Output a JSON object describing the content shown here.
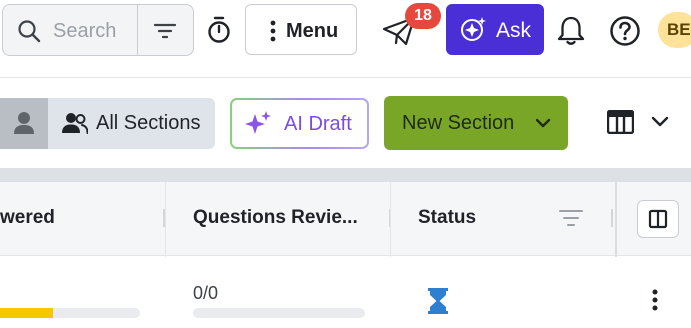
{
  "header": {
    "search_placeholder": "Search",
    "menu_label": "Menu",
    "notification_count": "18",
    "ask_label": "Ask",
    "avatar_initials": "BE"
  },
  "toolbar": {
    "sections_label": "All Sections",
    "ai_draft_label": "AI Draft",
    "new_section_label": "New Section"
  },
  "table": {
    "columns": [
      "wered",
      "Questions Revie...",
      "Status"
    ],
    "row": {
      "answered_progress": 0.38,
      "reviewed_text": "0/0",
      "reviewed_progress": 0
    }
  },
  "colors": {
    "ask_button": "#4b2fd6",
    "new_section_button": "#7aa628",
    "badge": "#e5483d",
    "answered_bar": "#f7c800",
    "status_icon": "#2f7fd0",
    "avatar_bg": "#fde39a"
  },
  "icons": [
    "search-icon",
    "filter-icon",
    "timer-icon",
    "more-vertical-icon",
    "paper-plane-icon",
    "sparkle-icon",
    "bell-icon",
    "help-icon",
    "person-icon",
    "users-icon",
    "chevron-down-icon",
    "table-layout-icon",
    "columns-icon",
    "hourglass-icon"
  ]
}
